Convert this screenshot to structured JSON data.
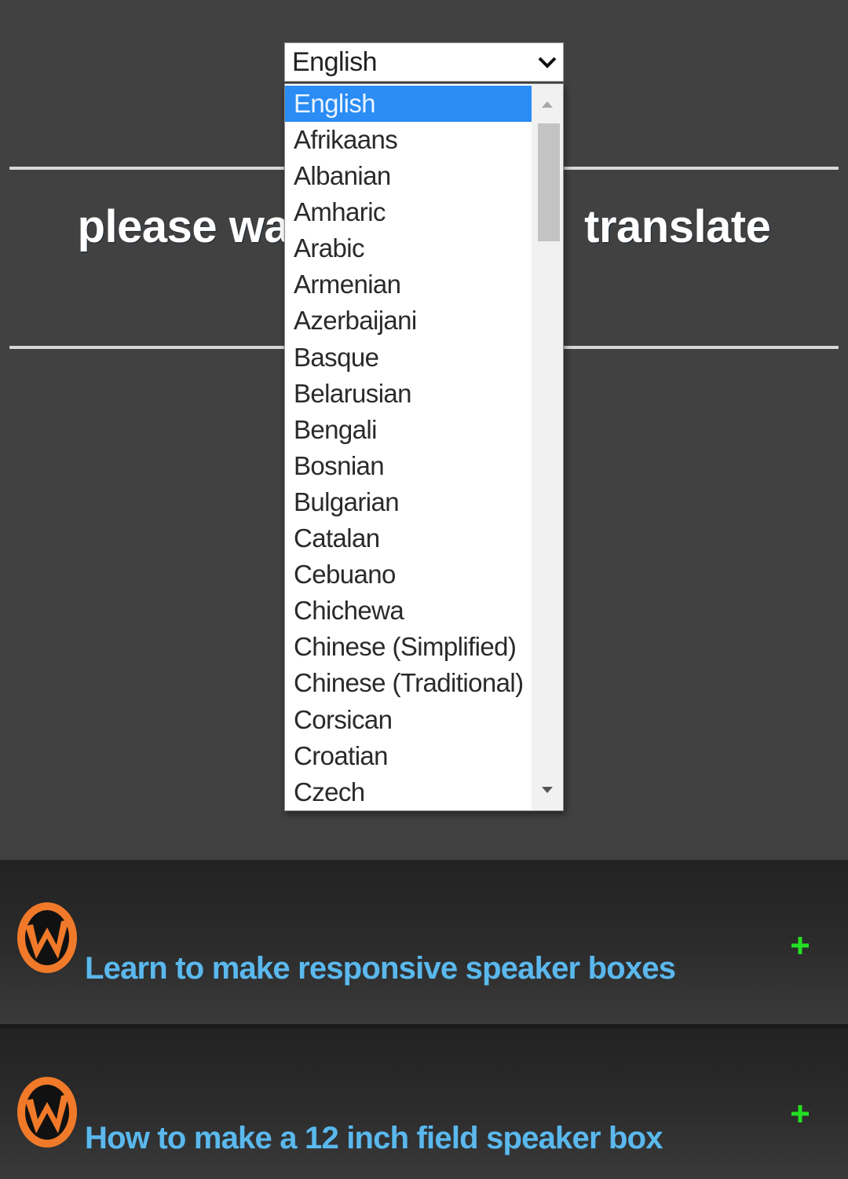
{
  "language_select": {
    "selected_value": "English",
    "options": [
      "English",
      "Afrikaans",
      "Albanian",
      "Amharic",
      "Arabic",
      "Armenian",
      "Azerbaijani",
      "Basque",
      "Belarusian",
      "Bengali",
      "Bosnian",
      "Bulgarian",
      "Catalan",
      "Cebuano",
      "Chichewa",
      "Chinese (Simplified)",
      "Chinese (Traditional)",
      "Corsican",
      "Croatian",
      "Czech"
    ],
    "highlighted_index": 0
  },
  "wait_message": {
    "left_text": "please wa",
    "right_text": "translate"
  },
  "articles": [
    {
      "title": "Learn to make responsive speaker boxes",
      "expand_icon": "plus-icon"
    },
    {
      "title": "How to make a 12 inch field speaker box",
      "expand_icon": "plus-icon"
    }
  ],
  "colors": {
    "background": "#414141",
    "highlight": "#2a8cf4",
    "link": "#5bb8ec",
    "plus": "#22e022",
    "logo_orange": "#f07a2a"
  }
}
